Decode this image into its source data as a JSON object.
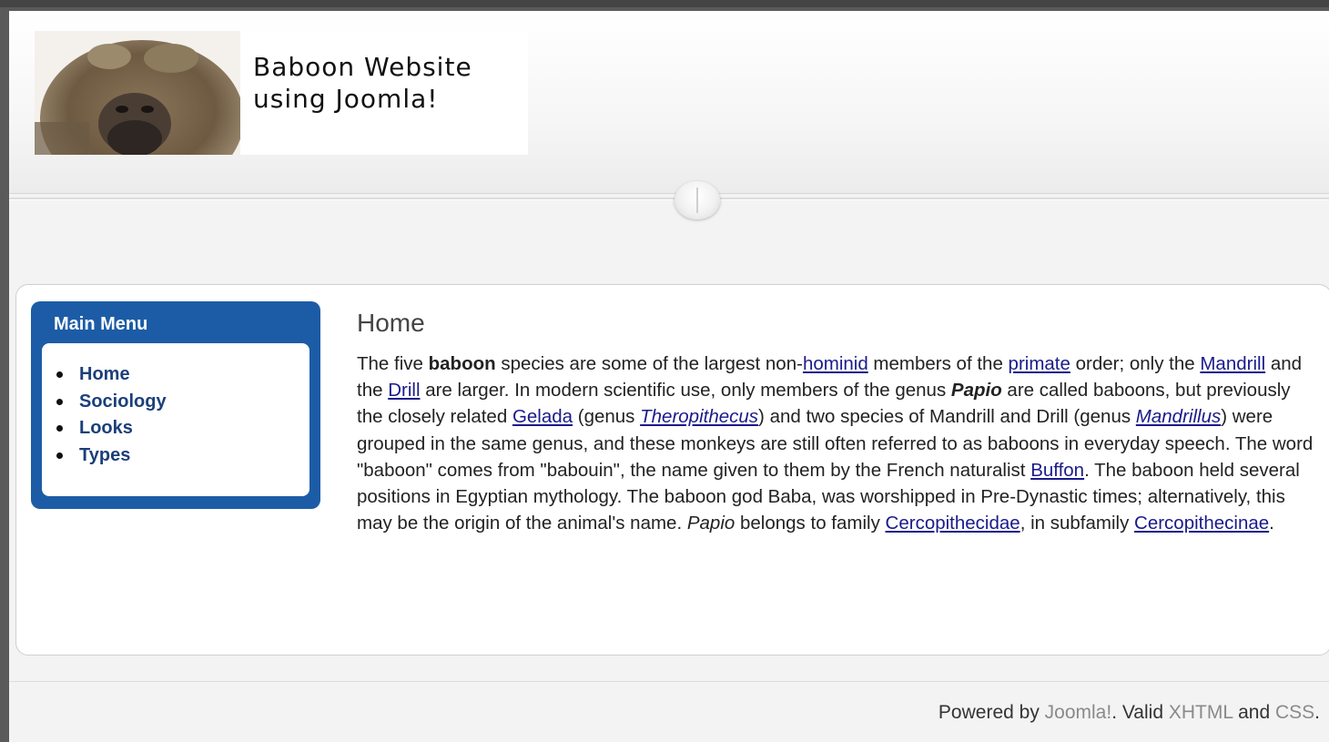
{
  "header": {
    "site_title_line1": "Baboon Website",
    "site_title_line2": "using Joomla!"
  },
  "menu": {
    "title": "Main Menu",
    "items": [
      {
        "label": "Home"
      },
      {
        "label": "Sociology"
      },
      {
        "label": "Looks"
      },
      {
        "label": "Types"
      }
    ]
  },
  "article": {
    "title": "Home",
    "t1": "The five ",
    "b1": "baboon",
    "t2": " species are some of the largest non-",
    "l_hominid": "hominid",
    "t3": " members of the ",
    "l_primate": "primate",
    "t4": " order; only the ",
    "l_mandrill": "Mandrill",
    "t5": " and the ",
    "l_drill": "Drill",
    "t6": " are larger. In modern scientific use, only members of the genus ",
    "b2": "Papio",
    "t7": " are called baboons, but previously the closely related ",
    "l_gelada": "Gelada",
    "t8": " (genus ",
    "l_theropithecus": "Theropithecus",
    "t9": ") and two species of Mandrill and Drill (genus ",
    "l_mandrillus": "Mandrillus",
    "t10": ") were grouped in the same genus, and these monkeys are still often referred to as baboons in everyday speech. The word \"baboon\" comes from \"babouin\", the name given to them by the French naturalist ",
    "l_buffon": "Buffon",
    "t11": ". The baboon held several positions in Egyptian mythology. The baboon god Baba, was worshipped in Pre-Dynastic times; alternatively, this may be the origin of the animal's name. ",
    "i1": "Papio",
    "t12": " belongs to family ",
    "l_cercopithecidae": "Cercopithecidae",
    "t13": ", in subfamily ",
    "l_cercopithecinae": "Cercopithecinae",
    "t14": "."
  },
  "footer": {
    "powered": "Powered by ",
    "joomla": "Joomla!",
    "sep1": ". Valid ",
    "xhtml": "XHTML",
    "and": " and ",
    "css": "CSS",
    "end": "."
  }
}
